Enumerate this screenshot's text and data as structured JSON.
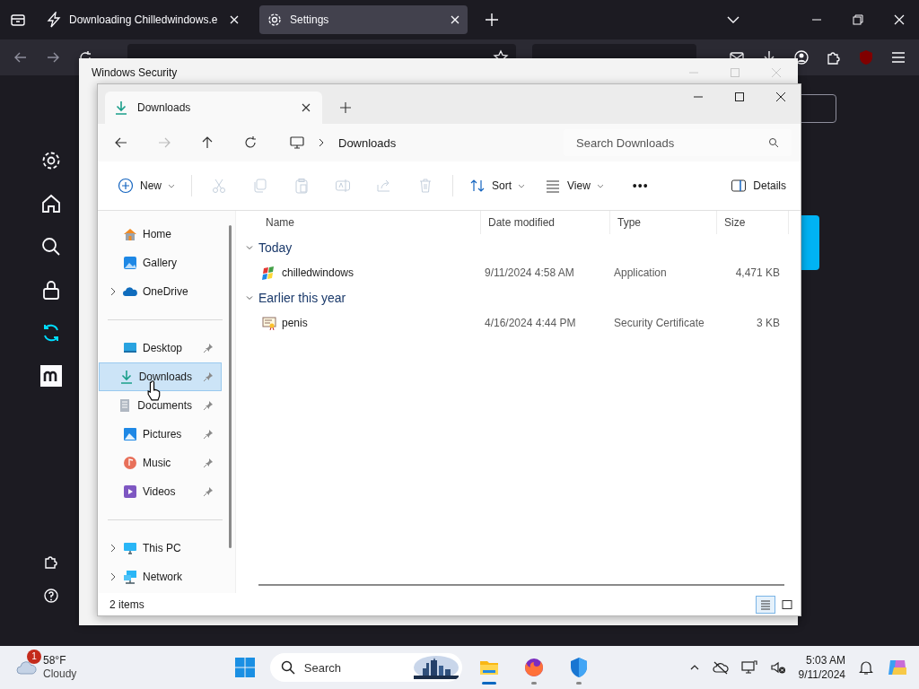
{
  "browser": {
    "tabs": [
      {
        "label": "Downloading Chilledwindows.e",
        "selected": false,
        "kind": "download"
      },
      {
        "label": "Settings",
        "selected": true,
        "kind": "gear"
      }
    ],
    "sidebar": [
      {
        "kind": "gear",
        "selected": false
      },
      {
        "kind": "home",
        "selected": false
      },
      {
        "kind": "search",
        "selected": false
      },
      {
        "kind": "lock",
        "selected": false
      },
      {
        "kind": "sync",
        "selected": true
      },
      {
        "kind": "m",
        "selected": false
      }
    ],
    "sidebar_footer": [
      {
        "kind": "puzzle"
      },
      {
        "kind": "help"
      }
    ]
  },
  "security_window": {
    "title": "Windows Security"
  },
  "explorer": {
    "tab": "Downloads",
    "address": "Downloads",
    "search_placeholder": "Search Downloads",
    "toolbar": {
      "new": "New",
      "actions": [
        {
          "kind": "cut",
          "disabled": true
        },
        {
          "kind": "copy",
          "disabled": true
        },
        {
          "kind": "paste",
          "disabled": true
        },
        {
          "kind": "rename",
          "disabled": true
        },
        {
          "kind": "share",
          "disabled": true
        },
        {
          "kind": "delete",
          "disabled": true
        }
      ],
      "sort": "Sort",
      "view": "View",
      "more": "•••",
      "details": "Details"
    },
    "nav": [
      [
        {
          "label": "Home",
          "kind": "home",
          "pinned": false,
          "expandable": false,
          "selected": false
        },
        {
          "label": "Gallery",
          "kind": "gallery",
          "pinned": false,
          "expandable": false,
          "selected": false
        },
        {
          "label": "OneDrive",
          "kind": "cloud",
          "pinned": false,
          "expandable": true,
          "selected": false
        }
      ],
      [
        {
          "label": "Desktop",
          "kind": "desktop",
          "pinned": true,
          "expandable": false,
          "selected": false
        },
        {
          "label": "Downloads",
          "kind": "download",
          "pinned": true,
          "expandable": false,
          "selected": true
        },
        {
          "label": "Documents",
          "kind": "documents",
          "pinned": true,
          "expandable": false,
          "selected": false
        },
        {
          "label": "Pictures",
          "kind": "pictures",
          "pinned": true,
          "expandable": false,
          "selected": false
        },
        {
          "label": "Music",
          "kind": "music",
          "pinned": true,
          "expandable": false,
          "selected": false
        },
        {
          "label": "Videos",
          "kind": "videos",
          "pinned": true,
          "expandable": false,
          "selected": false
        }
      ],
      [
        {
          "label": "This PC",
          "kind": "pc",
          "pinned": false,
          "expandable": true,
          "selected": false
        },
        {
          "label": "Network",
          "kind": "network",
          "pinned": false,
          "expandable": true,
          "selected": false
        }
      ]
    ],
    "columns": [
      "Name",
      "Date modified",
      "Type",
      "Size"
    ],
    "groups": [
      {
        "label": "Today",
        "expanded": true,
        "files": [
          {
            "name": "chilledwindows",
            "date": "9/11/2024 4:58 AM",
            "type": "Application",
            "size": "4,471 KB",
            "kind": "app"
          }
        ]
      },
      {
        "label": "Earlier this year",
        "expanded": true,
        "files": [
          {
            "name": "penis",
            "date": "4/16/2024 4:44 PM",
            "type": "Security Certificate",
            "size": "3 KB",
            "kind": "certificate"
          }
        ]
      }
    ],
    "status": "2 items",
    "view_modes": [
      {
        "kind": "details",
        "selected": true
      },
      {
        "kind": "tiles",
        "selected": false
      }
    ]
  },
  "taskbar": {
    "weather": {
      "badge": "1",
      "temp": "58°F",
      "condition": "Cloudy"
    },
    "search_placeholder": "Search",
    "apps": [
      {
        "kind": "explorer",
        "running": true
      },
      {
        "kind": "firefox",
        "running": true
      },
      {
        "kind": "defender",
        "running": true
      }
    ],
    "time": "5:03 AM",
    "date": "9/11/2024"
  }
}
